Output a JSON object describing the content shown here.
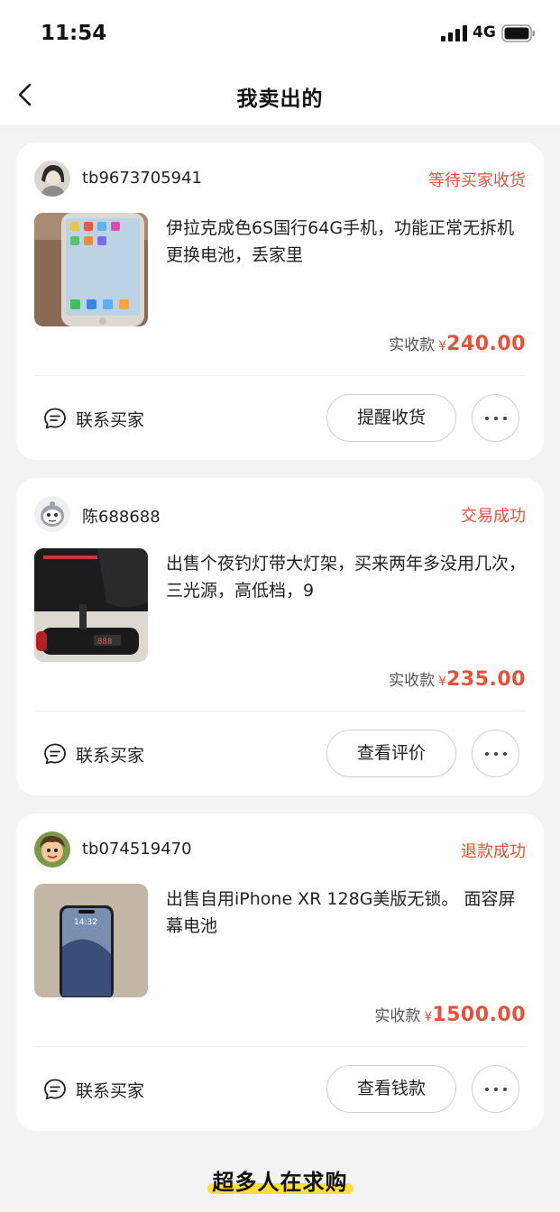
{
  "status_bar": {
    "time": "11:54",
    "network": "4G"
  },
  "nav": {
    "title": "我卖出的"
  },
  "orders": [
    {
      "username": "tb9673705941",
      "status": "等待买家收货",
      "description": "伊拉克成色6S国行64G手机，功能正常无拆机更换电池，丢家里",
      "price_label": "实收款",
      "currency": "¥",
      "amount": "240.00",
      "contact_label": "联系买家",
      "action_label": "提醒收货"
    },
    {
      "username": "陈688688",
      "status": "交易成功",
      "description": "出售个夜钓灯带大灯架，买来两年多没用几次，三光源，高低档，9",
      "price_label": "实收款",
      "currency": "¥",
      "amount": "235.00",
      "contact_label": "联系买家",
      "action_label": "查看评价"
    },
    {
      "username": "tb074519470",
      "status": "退款成功",
      "description": "出售自用iPhone XR 128G美版无锁。 面容屏幕电池",
      "price_label": "实收款",
      "currency": "¥",
      "amount": "1500.00",
      "contact_label": "联系买家",
      "action_label": "查看钱款"
    }
  ],
  "footer": {
    "title": "超多人在求购"
  },
  "colors": {
    "accent_red": "#e8503a",
    "highlight_yellow": "#ffe033",
    "background": "#f3f3f3"
  },
  "icons": [
    "back-arrow-icon",
    "chat-bubble-icon",
    "more-dots-icon",
    "signal-icon",
    "battery-icon"
  ]
}
